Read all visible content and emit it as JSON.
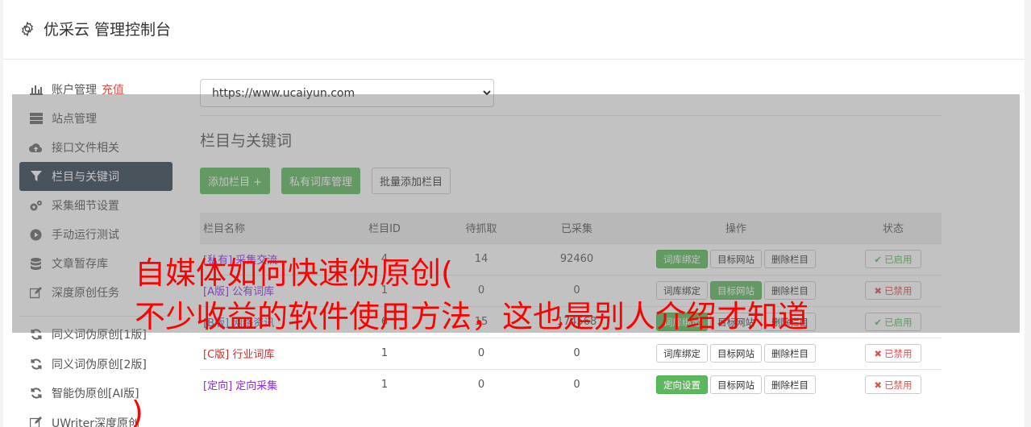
{
  "app": {
    "title": "优采云 管理控制台"
  },
  "sidebar": {
    "items": [
      {
        "label": "账户管理",
        "accent": "充值",
        "icon": "bar-chart-icon"
      },
      {
        "label": "站点管理",
        "icon": "server-icon"
      },
      {
        "label": "接口文件相关",
        "icon": "cloud-upload-icon"
      },
      {
        "label": "栏目与关键词",
        "icon": "filter-icon",
        "active": true
      },
      {
        "label": "采集细节设置",
        "icon": "cogs-icon"
      },
      {
        "label": "手动运行测试",
        "icon": "play-circle-icon"
      },
      {
        "label": "文章暂存库",
        "icon": "database-icon"
      },
      {
        "label": "深度原创任务",
        "icon": "edit-icon"
      }
    ],
    "tools": [
      {
        "label": "同义词伪原创[1版]",
        "icon": "refresh-icon"
      },
      {
        "label": "同义词伪原创[2版]",
        "icon": "refresh-icon"
      },
      {
        "label": "智能伪原创[AI版]",
        "icon": "refresh-icon"
      },
      {
        "label": "UWriter深度原创",
        "icon": "edit-icon"
      }
    ]
  },
  "main": {
    "site_select": {
      "value": "https://www.ucaiyun.com",
      "options": [
        "https://www.ucaiyun.com"
      ]
    },
    "section_title": "栏目与关键词",
    "buttons": {
      "add": "添加栏目 +",
      "private_lib": "私有词库管理",
      "batch_add": "批量添加栏目"
    },
    "table": {
      "headers": [
        "栏目名称",
        "栏目ID",
        "待抓取",
        "已采集",
        "操作",
        "状态"
      ],
      "rows": [
        {
          "name": "[私有] 采集交流",
          "id": "4",
          "pending": "14",
          "collected": "92460",
          "op1": "词库绑定",
          "op2": "目标网站",
          "op3": "删除栏目",
          "status": "已启用"
        },
        {
          "name": "[A版] 公有词库",
          "id": "1",
          "pending": "0",
          "collected": "0",
          "op1": "词库绑定",
          "op2": "目标网站",
          "op3": "删除栏目",
          "status": "已禁用"
        },
        {
          "name": "[B版] 网络资讯",
          "id": "6",
          "pending": "15",
          "collected": "174568",
          "op1": "词库绑定",
          "op2": "目标网站",
          "op3": "删除栏目",
          "status": "已启用"
        },
        {
          "name": "[C版] 行业词库",
          "id": "1",
          "pending": "0",
          "collected": "0",
          "op1": "词库绑定",
          "op2": "目标网站",
          "op3": "删除栏目",
          "status": "已禁用"
        },
        {
          "name": "[定向] 定向采集",
          "id": "1",
          "pending": "0",
          "collected": "0",
          "op1": "定向设置",
          "op2": "目标网站",
          "op3": "删除栏目",
          "status": "已禁用"
        }
      ]
    }
  },
  "overlay_text": {
    "line1": "自媒体如何快速伪原创(",
    "line2": "不少收益的软件使用方法，这也是别人介绍才知道",
    "line3": ")"
  },
  "colors": {
    "accent_green": "#5cb85c",
    "active_nav": "#2f4050",
    "danger": "#d9534f",
    "overlay_text": "#ff0000"
  }
}
